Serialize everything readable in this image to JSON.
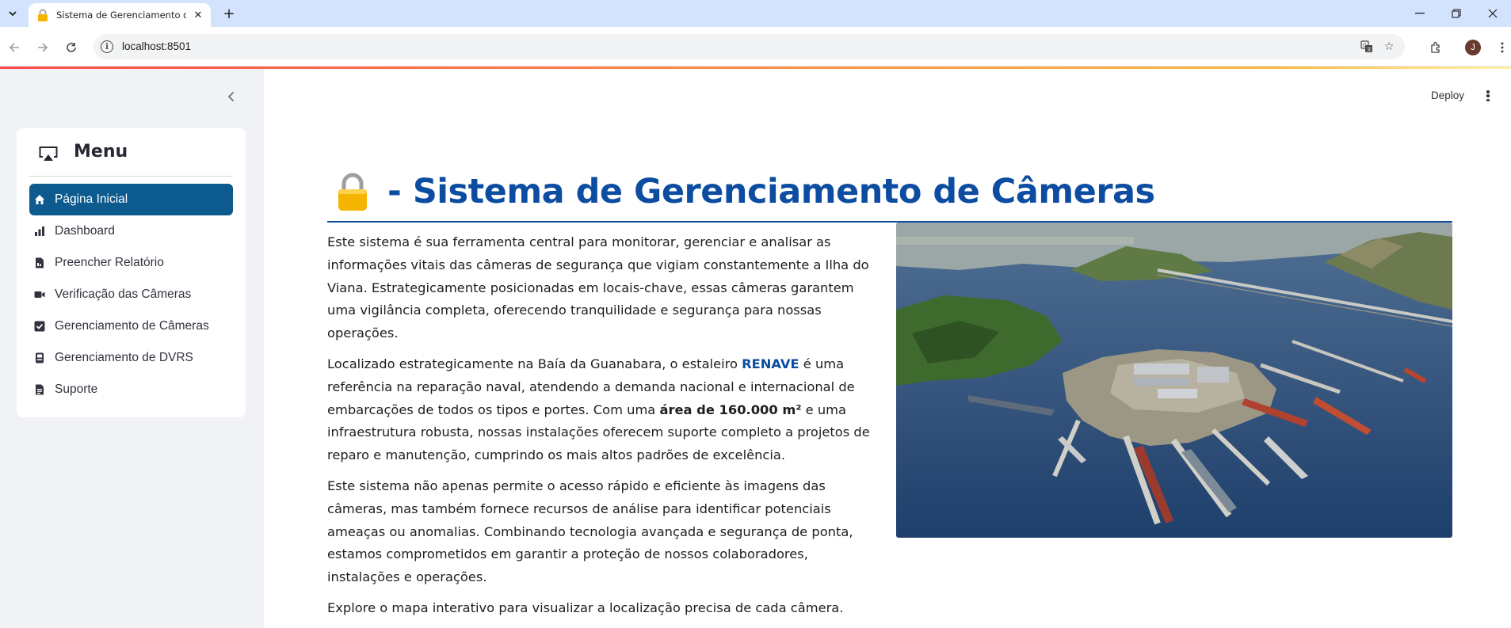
{
  "browser": {
    "tab_title": "Sistema de Gerenciamento de Câmeras",
    "url": "localhost:8501",
    "profile_initial": "J"
  },
  "app": {
    "deploy_label": "Deploy"
  },
  "sidebar": {
    "menu_title": "Menu",
    "items": [
      {
        "label": "Página Inicial",
        "icon": "house-icon",
        "active": true
      },
      {
        "label": "Dashboard",
        "icon": "bar-chart-icon",
        "active": false
      },
      {
        "label": "Preencher Relatório",
        "icon": "report-icon",
        "active": false
      },
      {
        "label": "Verificação das Câmeras",
        "icon": "camera-video-icon",
        "active": false
      },
      {
        "label": "Gerenciamento de Câmeras",
        "icon": "check-square-icon",
        "active": false
      },
      {
        "label": "Gerenciamento de DVRS",
        "icon": "dvr-device-icon",
        "active": false
      },
      {
        "label": "Suporte",
        "icon": "support-doc-icon",
        "active": false
      }
    ]
  },
  "page": {
    "title": "- Sistema de Gerenciamento de Câmeras",
    "paragraph1": "Este sistema é sua ferramenta central para monitorar, gerenciar e analisar as informações vitais das câmeras de segurança que vigiam constantemente a Ilha do Viana. Estrategicamente posicionadas em locais-chave, essas câmeras garantem uma vigilância completa, oferecendo tranquilidade e segurança para nossas operações.",
    "paragraph2": {
      "part1": "Localizado estrategicamente na Baía da Guanabara, o estaleiro ",
      "renave": "RENAVE",
      "part2": " é uma referência na reparação naval, atendendo a demanda nacional e internacional de embarcações de todos os tipos e portes. Com uma ",
      "area": "área de 160.000 m²",
      "part3": " e uma infraestrutura robusta, nossas instalações oferecem suporte completo a projetos de reparo e manutenção, cumprindo os mais altos padrões de excelência."
    },
    "paragraph3": "Este sistema não apenas permite o acesso rápido e eficiente às imagens das câmeras, mas também fornece recursos de análise para identificar potenciais ameaças ou anomalias. Combinando tecnologia avançada e segurança de ponta, estamos comprometidos em garantir a proteção de nossos colaboradores, instalações e operações.",
    "paragraph4": "Explore o mapa interativo para visualizar a localização precisa de cada câmera."
  },
  "colors": {
    "accent": "#0c4da2",
    "active_item_bg": "#0c5a8e",
    "sidebar_bg": "#f0f2f6"
  }
}
